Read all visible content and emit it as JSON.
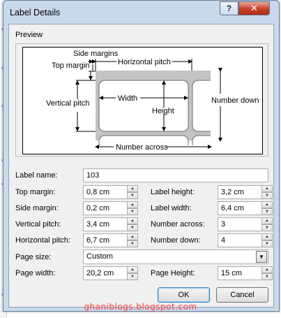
{
  "window": {
    "title": "Label Details",
    "help_icon": "question-icon",
    "close_icon": "close-icon"
  },
  "preview": {
    "heading": "Preview",
    "labels": {
      "side_margins": "Side margins",
      "horizontal_pitch": "Horizontal pitch",
      "top_margin": "Top margin",
      "width": "Width",
      "vertical_pitch": "Vertical pitch",
      "height": "Height",
      "number_down": "Number down",
      "number_across": "Number across"
    }
  },
  "form": {
    "label_name": {
      "label": "Label name:",
      "value": "103"
    },
    "top_margin": {
      "label": "Top margin:",
      "value": "0,8 cm"
    },
    "side_margin": {
      "label": "Side margin:",
      "value": "0,2 cm"
    },
    "vertical_pitch": {
      "label": "Vertical pitch:",
      "value": "3,4 cm"
    },
    "horizontal_pitch": {
      "label": "Horizontal pitch:",
      "value": "6,7 cm"
    },
    "label_height": {
      "label": "Label height:",
      "value": "3,2 cm"
    },
    "label_width": {
      "label": "Label width:",
      "value": "6,4 cm"
    },
    "number_across": {
      "label": "Number across:",
      "value": "3"
    },
    "number_down": {
      "label": "Number down:",
      "value": "4"
    },
    "page_size": {
      "label": "Page size:",
      "value": "Custom"
    },
    "page_width": {
      "label": "Page width:",
      "value": "20,2 cm"
    },
    "page_height": {
      "label": "Page Height:",
      "value": "15 cm"
    }
  },
  "buttons": {
    "ok": "OK",
    "cancel": "Cancel"
  },
  "watermark": "ghaniblogs.blogspot.com"
}
